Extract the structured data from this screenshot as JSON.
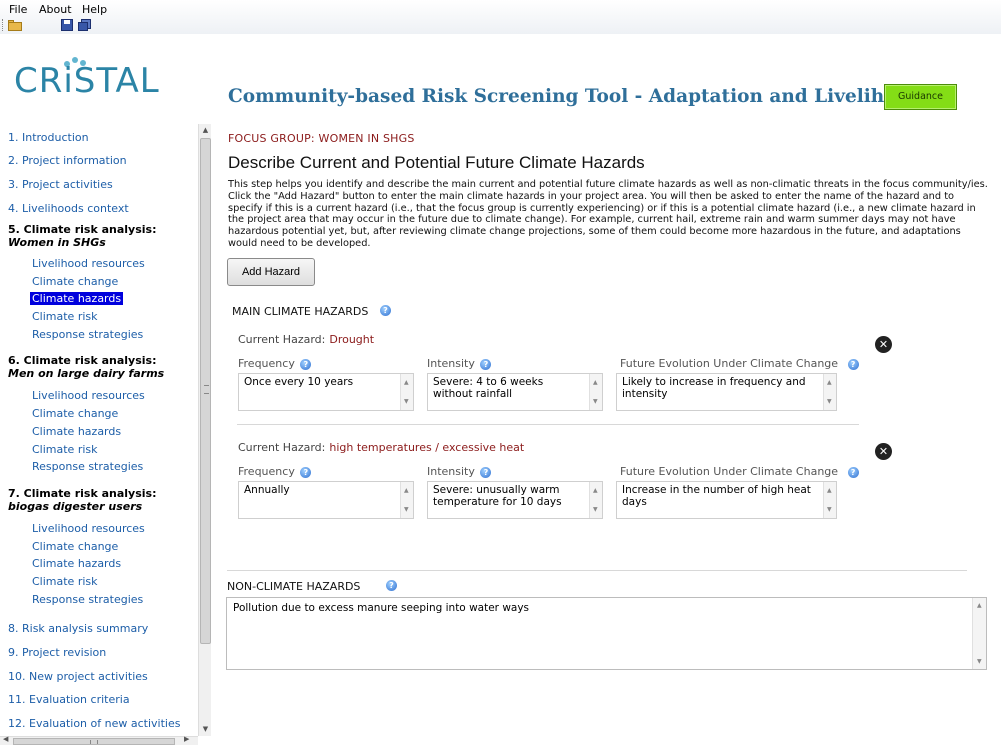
{
  "menu": {
    "file": "File",
    "about": "About",
    "help": "Help"
  },
  "logo": {
    "text": "CRiSTAL",
    "color": "#2b84a6"
  },
  "header": {
    "title": "Community-based Risk Screening Tool - Adaptation and Livelihoods",
    "guidance_label": "Guidance"
  },
  "sidebar": {
    "items": [
      {
        "label": "1. Introduction"
      },
      {
        "label": "2. Project information"
      },
      {
        "label": "3. Project activities"
      },
      {
        "label": "4. Livelihoods context"
      },
      {
        "label": "5. Climate risk analysis:",
        "sub": "Women in SHGs"
      },
      {
        "label": "Livelihood resources"
      },
      {
        "label": "Climate change"
      },
      {
        "label": "Climate hazards",
        "active": true
      },
      {
        "label": "Climate risk"
      },
      {
        "label": "Response strategies"
      },
      {
        "label": "6. Climate risk analysis:",
        "sub": "Men on large dairy farms"
      },
      {
        "label": "Livelihood resources"
      },
      {
        "label": "Climate change"
      },
      {
        "label": "Climate hazards"
      },
      {
        "label": "Climate risk"
      },
      {
        "label": "Response strategies"
      },
      {
        "label": "7. Climate risk analysis:",
        "sub": "biogas digester users"
      },
      {
        "label": "Livelihood resources"
      },
      {
        "label": "Climate change"
      },
      {
        "label": "Climate hazards"
      },
      {
        "label": "Climate risk"
      },
      {
        "label": "Response strategies"
      },
      {
        "label": "8. Risk analysis summary"
      },
      {
        "label": "9. Project revision"
      },
      {
        "label": "10. New project activities"
      },
      {
        "label": "11. Evaluation criteria"
      },
      {
        "label": "12. Evaluation of new activities"
      }
    ]
  },
  "main": {
    "focus_group": "FOCUS GROUP: WOMEN IN SHGS",
    "heading": "Describe Current and Potential Future Climate Hazards",
    "intro": "This step helps you identify and describe the main current and potential future climate hazards as well as non-climatic threats in the focus community/ies. Click the \"Add Hazard\" button to enter the main climate hazards in your project area. You will then be asked to enter the name of the hazard and to specify if this is a current hazard (i.e., that the focus group is currently experiencing) or if this is a potential climate hazard (i.e., a new climate hazard in the project area that may occur in the future due to climate change). For example, current hail, extreme rain and warm summer days may not have hazardous potential yet, but, after reviewing climate change projections, some of them could become more hazardous in the future, and adaptations would need to be developed.",
    "add_hazard_label": "Add Hazard",
    "main_hazards_label": "MAIN CLIMATE HAZARDS",
    "current_hazard_label": "Current Hazard:",
    "frequency_label": "Frequency",
    "intensity_label": "Intensity",
    "future_label": "Future Evolution Under Climate Change",
    "hazards": [
      {
        "name": "Drought",
        "frequency": "Once every 10 years",
        "intensity": "Severe: 4 to 6 weeks without rainfall",
        "future": "Likely to increase in frequency and intensity"
      },
      {
        "name": "high temperatures / excessive heat",
        "frequency": "Annually",
        "intensity": "Severe: unusually warm temperature for 10 days",
        "future": "Increase in the number of high heat days"
      }
    ],
    "non_climate_label": "NON-CLIMATE HAZARDS",
    "non_climate_value": "Pollution due to excess manure seeping into water ways"
  }
}
